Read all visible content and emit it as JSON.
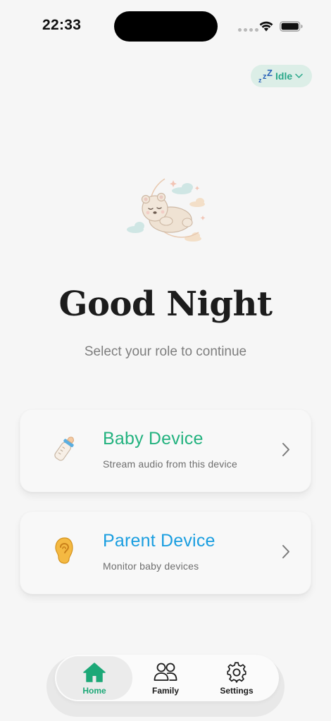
{
  "status_bar": {
    "time": "22:33"
  },
  "header": {
    "status_pill": {
      "label": "Idle",
      "icon": "sleep-zz-icon"
    }
  },
  "hero": {
    "illustration": "sleeping-bear-on-moon",
    "title": "Good Night",
    "subtitle": "Select your role to continue"
  },
  "roles": [
    {
      "title": "Baby Device",
      "description": "Stream audio from this device",
      "icon": "baby-bottle-icon",
      "color": "#23b27f"
    },
    {
      "title": "Parent Device",
      "description": "Monitor baby devices",
      "icon": "ear-icon",
      "color": "#1a9ee0"
    }
  ],
  "tab_bar": {
    "tabs": [
      {
        "label": "Home",
        "icon": "home-icon",
        "active": true
      },
      {
        "label": "Family",
        "icon": "people-icon",
        "active": false
      },
      {
        "label": "Settings",
        "icon": "gear-icon",
        "active": false
      }
    ]
  },
  "colors": {
    "accent_green": "#1ca877",
    "accent_blue": "#1a9ee0",
    "background": "#f6f6f6",
    "pill_background": "#dceee7"
  }
}
